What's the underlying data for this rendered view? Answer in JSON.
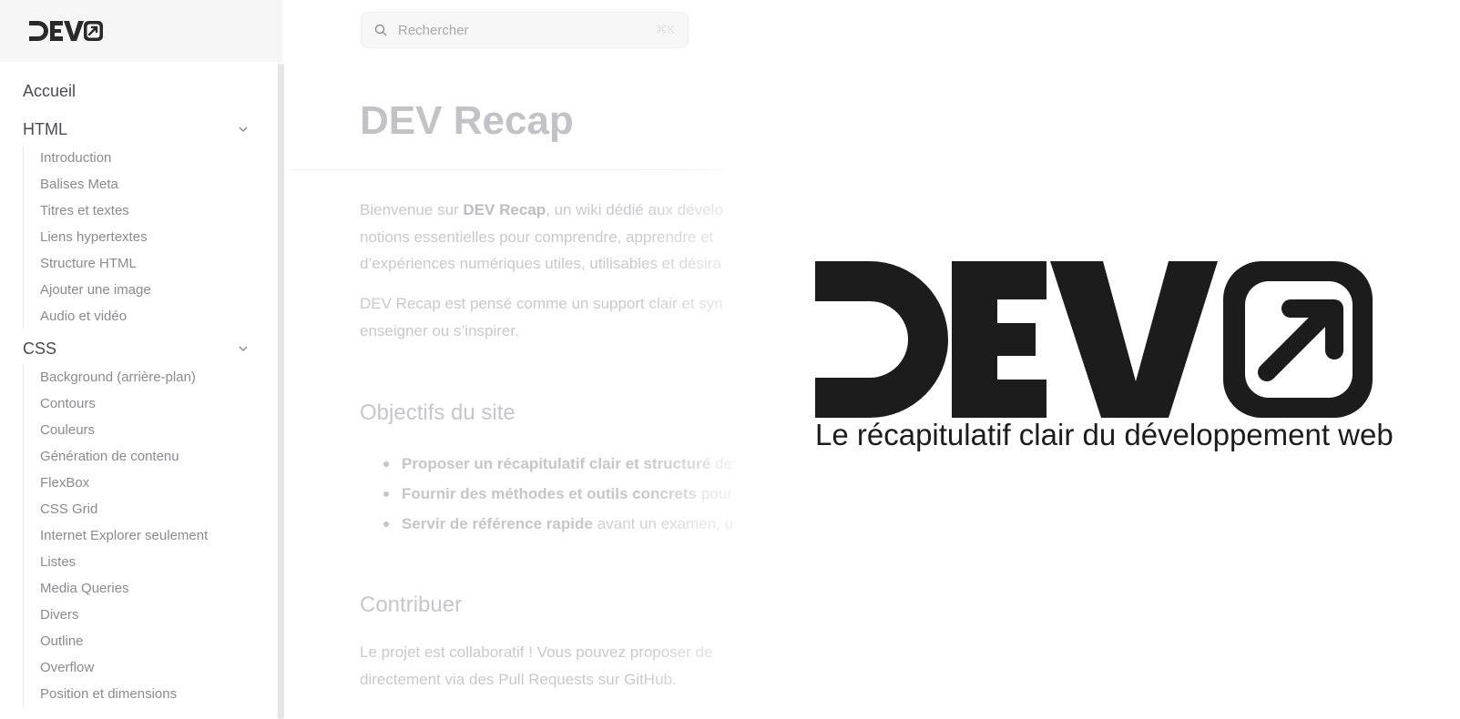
{
  "header": {
    "brand": "DEV",
    "search_placeholder": "Rechercher",
    "search_shortcut": "⌘K"
  },
  "sidebar": {
    "home": "Accueil",
    "sections": [
      {
        "label": "HTML",
        "items": [
          "Introduction",
          "Balises Meta",
          "Titres et textes",
          "Liens hypertextes",
          "Structure HTML",
          "Ajouter une image",
          "Audio et vidéo"
        ]
      },
      {
        "label": "CSS",
        "items": [
          "Background (arrière-plan)",
          "Contours",
          "Couleurs",
          "Génération de contenu",
          "FlexBox",
          "CSS Grid",
          "Internet Explorer seulement",
          "Listes",
          "Media Queries",
          "Divers",
          "Outline",
          "Overflow",
          "Position et dimensions"
        ]
      }
    ]
  },
  "main": {
    "title_bold": "DEV",
    "title_rest": "Recap",
    "intro": {
      "prefix": "Bienvenue sur ",
      "bold": "DEV Recap",
      "line1_rest": ", un wiki dédié aux dévelo",
      "line2": "notions essentielles pour comprendre, apprendre et",
      "line3": "d’expériences numériques utiles, utilisables et désira"
    },
    "intro2": {
      "line1": "DEV Recap est pensé comme un support clair et syn",
      "line2": "enseigner ou s’inspirer."
    },
    "objectives_heading": "Objectifs du site",
    "objectives": [
      {
        "bold": "Proposer un récapitulatif clair et structuré",
        "rest": "de"
      },
      {
        "bold": "Fournir des méthodes et outils concrets",
        "rest": "pour"
      },
      {
        "bold": "Servir de référence rapide",
        "rest": "avant un examen, u"
      }
    ],
    "contribute_heading": "Contribuer",
    "contribute": {
      "line1": "Le projet est collaboratif ! Vous pouvez proposer de",
      "line2": "directement via des Pull Requests sur GitHub."
    }
  },
  "overlay": {
    "logo_text": "DEV",
    "tagline": "Le récapitulatif clair du développement web"
  },
  "colors": {
    "logo": "#1c1c1c",
    "sidebar_text": "#8a8a93",
    "faded_text": "#c9c9cd"
  }
}
